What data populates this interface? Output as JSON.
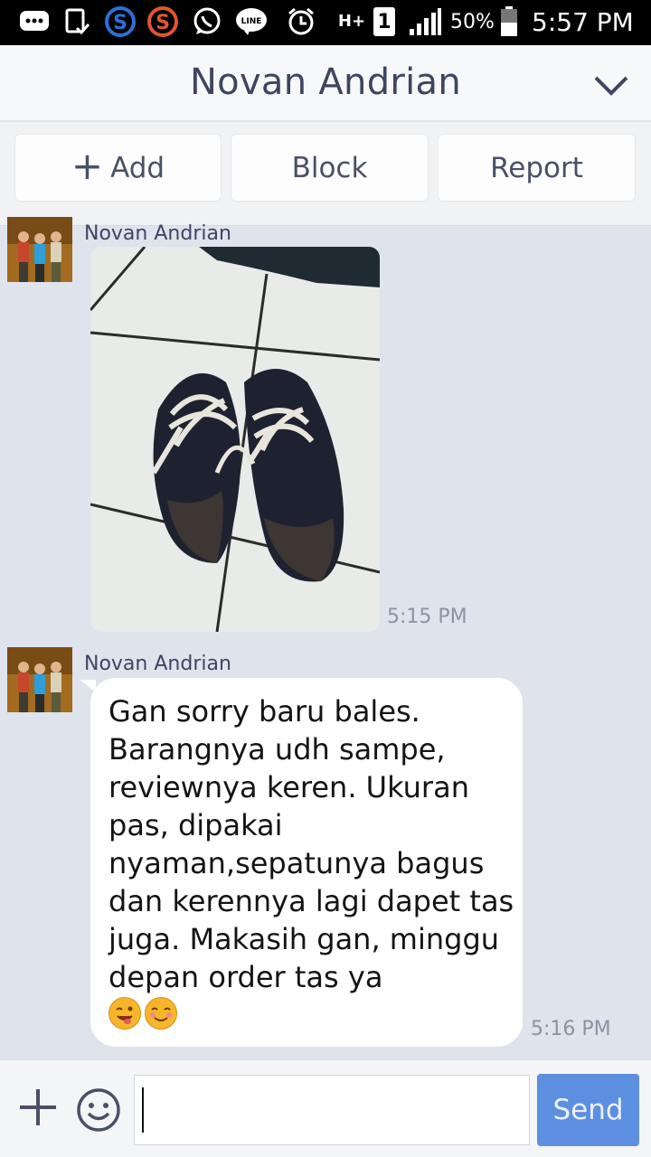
{
  "status_bar": {
    "battery_percent": "50%",
    "clock": "5:57 PM",
    "network_type": "H+",
    "sim_slot": "1",
    "icons": [
      "messages-icon",
      "screenshot-icon",
      "s-app-blue-icon",
      "s-app-orange-icon",
      "whatsapp-icon",
      "line-icon",
      "alarm-icon",
      "network-icon",
      "sim-icon",
      "signal-icon",
      "battery-icon"
    ]
  },
  "header": {
    "title": "Novan Andrian",
    "menu_icon": "chevron-down-icon"
  },
  "actions": {
    "add_plus": "+",
    "add_label": "Add",
    "block_label": "Block",
    "report_label": "Report"
  },
  "messages": [
    {
      "sender": "Novan Andrian",
      "type": "image",
      "image_description": "photo of black sneakers with white laces",
      "time": "5:15 PM"
    },
    {
      "sender": "Novan Andrian",
      "type": "text",
      "text": "Gan sorry baru bales. Barangnya udh sampe, reviewnya keren. Ukuran pas, dipakai nyaman,sepatunya bagus dan kerennya lagi dapet tas juga. Makasih gan, minggu depan order tas ya",
      "emojis": [
        "winking-face-tongue-emoji",
        "smiling-face-emoji"
      ],
      "time": "5:16 PM"
    }
  ],
  "input_bar": {
    "placeholder": "",
    "value": "",
    "send_label": "Send"
  },
  "colors": {
    "chat_background": "#dfe3ec",
    "header_text": "#3d4560",
    "send_button": "#5d8fe0",
    "bubble": "#ffffff"
  }
}
